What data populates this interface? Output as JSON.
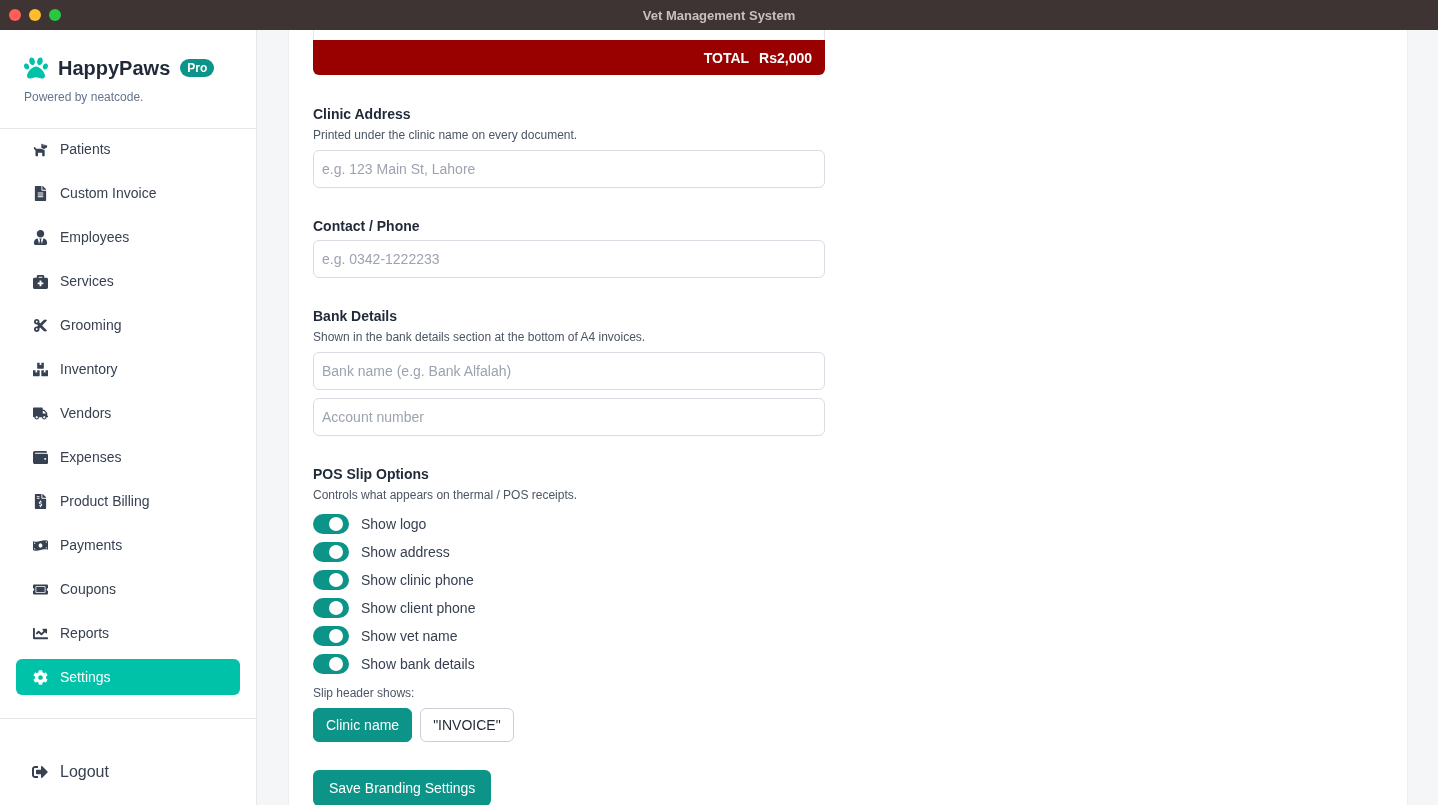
{
  "window": {
    "title": "Vet Management System"
  },
  "brand": {
    "name": "HappyPaws",
    "badge": "Pro",
    "tagline": "Powered by neatcode."
  },
  "sidebar": {
    "items": [
      {
        "label": "Patients",
        "selected": false
      },
      {
        "label": "Custom Invoice",
        "selected": false
      },
      {
        "label": "Employees",
        "selected": false
      },
      {
        "label": "Services",
        "selected": false
      },
      {
        "label": "Grooming",
        "selected": false
      },
      {
        "label": "Inventory",
        "selected": false
      },
      {
        "label": "Vendors",
        "selected": false
      },
      {
        "label": "Expenses",
        "selected": false
      },
      {
        "label": "Product Billing",
        "selected": false
      },
      {
        "label": "Payments",
        "selected": false
      },
      {
        "label": "Coupons",
        "selected": false
      },
      {
        "label": "Reports",
        "selected": false
      },
      {
        "label": "Settings",
        "selected": true
      }
    ],
    "logout": "Logout"
  },
  "preview": {
    "total_label": "TOTAL",
    "total_value": "Rs2,000"
  },
  "sections": [
    {
      "title": "Clinic Address",
      "hint": "Printed under the clinic name on every document.",
      "fields": [
        {
          "placeholder": "e.g. 123 Main St, Lahore"
        }
      ]
    },
    {
      "title": "Contact / Phone",
      "fields": [
        {
          "placeholder": "e.g. 0342-1222233"
        }
      ]
    },
    {
      "title": "Bank Details",
      "hint": "Shown in the bank details section at the bottom of A4 invoices.",
      "fields": [
        {
          "placeholder": "Bank name (e.g. Bank Alfalah)"
        },
        {
          "placeholder": "Account number"
        }
      ]
    }
  ],
  "pos": {
    "title": "POS Slip Options",
    "hint": "Controls what appears on thermal / POS receipts.",
    "toggles": [
      {
        "label": "Show logo",
        "on": true
      },
      {
        "label": "Show address",
        "on": true
      },
      {
        "label": "Show clinic phone",
        "on": true
      },
      {
        "label": "Show client phone",
        "on": true
      },
      {
        "label": "Show vet name",
        "on": true
      },
      {
        "label": "Show bank details",
        "on": true
      }
    ],
    "header_label": "Slip header shows:",
    "header_options": [
      {
        "label": "Clinic name",
        "selected": true
      },
      {
        "label": "\"INVOICE\"",
        "selected": false
      }
    ]
  },
  "save_button": "Save Branding Settings"
}
